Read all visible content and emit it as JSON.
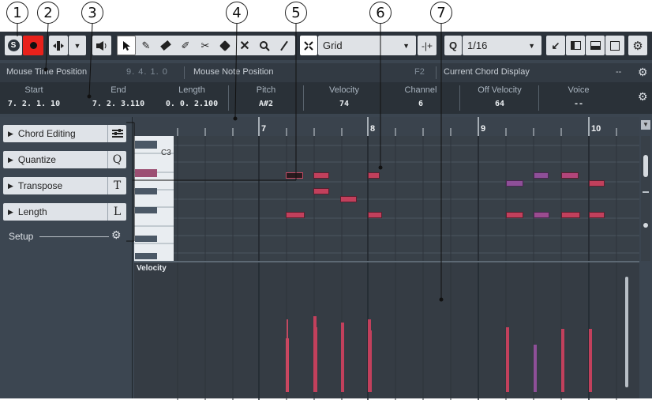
{
  "callouts": [
    "1",
    "2",
    "3",
    "4",
    "5",
    "6",
    "7"
  ],
  "toolbar": {
    "grid_type": "Grid",
    "quantize_value": "1/16",
    "colors": {
      "record": "#e8211b",
      "accent": "#dfe2e6"
    }
  },
  "infoline": {
    "mouse_time_label": "Mouse Time Position",
    "mouse_time_value": "9. 4. 1.  0",
    "mouse_note_label": "Mouse Note Position",
    "mouse_note_value": "F2",
    "chord_label": "Current Chord Display",
    "chord_value": "--"
  },
  "status": {
    "columns": [
      {
        "header": "Start",
        "value": "7. 2. 1. 10"
      },
      {
        "header": "End",
        "value": "7. 2. 3.110"
      },
      {
        "header": "Length",
        "value": "0. 0. 2.100"
      },
      {
        "header": "Pitch",
        "value": "A#2"
      },
      {
        "header": "Velocity",
        "value": "74"
      },
      {
        "header": "Channel",
        "value": "6"
      },
      {
        "header": "Off Velocity",
        "value": "64"
      },
      {
        "header": "Voice",
        "value": "--"
      }
    ]
  },
  "inspector": {
    "sections": [
      {
        "label": "Chord Editing",
        "icon": "chord-editing-icon"
      },
      {
        "label": "Quantize",
        "icon_text": "Q"
      },
      {
        "label": "Transpose",
        "icon_text": "T"
      },
      {
        "label": "Length",
        "icon_text": "L"
      }
    ],
    "setup_label": "Setup"
  },
  "ruler": {
    "bars": [
      "7",
      "8",
      "9",
      "10"
    ]
  },
  "keyboard": {
    "label": "C3"
  },
  "velocity": {
    "label": "Velocity"
  }
}
